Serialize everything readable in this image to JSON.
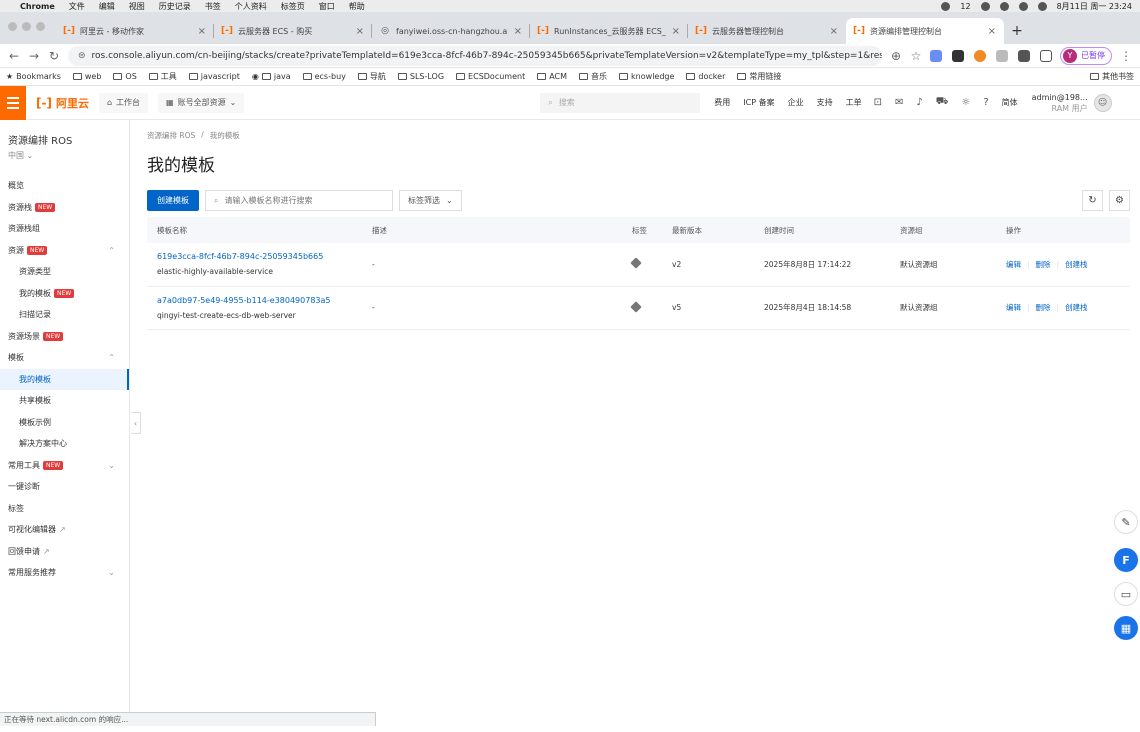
{
  "mac_menu": {
    "app": "Chrome",
    "items": [
      "文件",
      "编辑",
      "视图",
      "历史记录",
      "书签",
      "个人资料",
      "标签页",
      "窗口",
      "帮助"
    ],
    "battery": "12",
    "clock": "8月11日 周一 23:24"
  },
  "tabs": [
    {
      "label": "阿里云 - 移动作家",
      "icon": "aliyun-icon"
    },
    {
      "label": "云服务器 ECS - 购买",
      "icon": "aliyun-icon"
    },
    {
      "label": "fanyiwei.oss-cn-hangzhou.aliy",
      "icon": "globe-icon"
    },
    {
      "label": "RunInstances_云服务器 ECS_A",
      "icon": "aliyun-icon"
    },
    {
      "label": "云服务器管理控制台",
      "icon": "aliyun-icon"
    },
    {
      "label": "资源编排管理控制台",
      "icon": "aliyun-icon",
      "active": true
    }
  ],
  "address": {
    "url": "ros.console.aliyun.com/cn-beijing/stacks/create?privateTemplateId=619e3cca-8fcf-46b7-894c-25059345b665&privateTemplateVersion=v2&templateType=my_tpl&step=1&resour...",
    "profile_label": "已暂停",
    "profile_initial": "Y"
  },
  "bookmarks": {
    "items": [
      "Bookmarks",
      "web",
      "OS",
      "工具",
      "javascript",
      "java",
      "ecs-buy",
      "导航",
      "SLS-LOG",
      "ECSDocument",
      "ACM",
      "音乐",
      "knowledge",
      "docker",
      "常用链接"
    ],
    "other": "其他书签"
  },
  "topnav": {
    "logo": "阿里云",
    "workbench": "工作台",
    "account_scope": "账号全部资源",
    "search_placeholder": "搜索",
    "links": [
      "费用",
      "ICP 备案",
      "企业",
      "支持",
      "工单"
    ],
    "lang": "简体",
    "account": "admin@198...",
    "account_sub": "RAM 用户"
  },
  "sidebar": {
    "title": "资源编排 ROS",
    "region": "中国",
    "items": [
      {
        "label": "概览"
      },
      {
        "label": "资源栈",
        "badge": "NEW"
      },
      {
        "label": "资源栈组"
      },
      {
        "label": "资源",
        "badge": "NEW",
        "chevron": "up"
      },
      {
        "label": "资源类型",
        "child": true
      },
      {
        "label": "我的模板",
        "badge": "NEW",
        "child": true
      },
      {
        "label": "扫描记录",
        "child": true
      },
      {
        "label": "资源场景",
        "badge": "NEW"
      },
      {
        "label": "模板",
        "chevron": "up"
      },
      {
        "label": "我的模板",
        "child": true,
        "active": true
      },
      {
        "label": "共享模板",
        "child": true
      },
      {
        "label": "模板示例",
        "child": true
      },
      {
        "label": "解决方案中心",
        "child": true
      },
      {
        "label": "常用工具",
        "badge": "NEW",
        "chevron": "down"
      },
      {
        "label": "一键诊断"
      },
      {
        "label": "标签"
      },
      {
        "label": "可视化编辑器",
        "external": true
      },
      {
        "label": "回馈申请",
        "external": true
      },
      {
        "label": "常用服务推荐",
        "chevron": "down"
      }
    ]
  },
  "breadcrumb": {
    "root": "资源编排 ROS",
    "sep": "/",
    "current": "我的模板"
  },
  "page_title": "我的模板",
  "toolbar": {
    "create_label": "创建模板",
    "search_placeholder": "请输入模板名称进行搜索",
    "filter_label": "标签筛选"
  },
  "table": {
    "columns": [
      "模板名称",
      "描述",
      "标签",
      "最新版本",
      "创建时间",
      "资源组",
      "操作"
    ],
    "rows": [
      {
        "id": "619e3cca-8fcf-46b7-894c-25059345b665",
        "name": "elastic-highly-available-service",
        "desc": "-",
        "version": "v2",
        "created": "2025年8月8日 17:14:22",
        "group": "默认资源组",
        "ops": [
          "编辑",
          "删除",
          "创建栈"
        ]
      },
      {
        "id": "a7a0db97-5e49-4955-b114-e380490783a5",
        "name": "qingyi-test-create-ecs-db-web-server",
        "desc": "-",
        "version": "v5",
        "created": "2025年8月4日 18:14:58",
        "group": "默认资源组",
        "ops": [
          "编辑",
          "删除",
          "创建栈"
        ]
      }
    ]
  },
  "status_bar": "正在等待 next.alicdn.com 的响应...",
  "colors": {
    "brand": "#ff6a00",
    "primary": "#0064c8",
    "new_badge": "#e23b3b"
  }
}
